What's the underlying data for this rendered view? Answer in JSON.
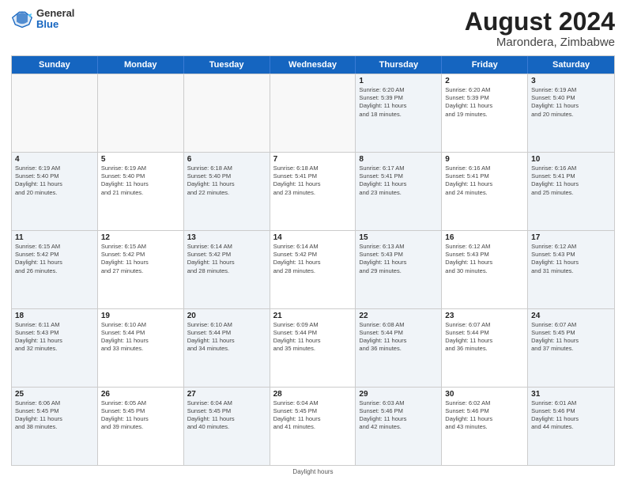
{
  "header": {
    "logo_general": "General",
    "logo_blue": "Blue",
    "month_title": "August 2024",
    "subtitle": "Marondera, Zimbabwe"
  },
  "footer": {
    "note": "Daylight hours"
  },
  "weekdays": [
    "Sunday",
    "Monday",
    "Tuesday",
    "Wednesday",
    "Thursday",
    "Friday",
    "Saturday"
  ],
  "weeks": [
    [
      {
        "day": "",
        "info": "",
        "empty": true
      },
      {
        "day": "",
        "info": "",
        "empty": true
      },
      {
        "day": "",
        "info": "",
        "empty": true
      },
      {
        "day": "",
        "info": "",
        "empty": true
      },
      {
        "day": "1",
        "info": "Sunrise: 6:20 AM\nSunset: 5:39 PM\nDaylight: 11 hours\nand 18 minutes.",
        "empty": false
      },
      {
        "day": "2",
        "info": "Sunrise: 6:20 AM\nSunset: 5:39 PM\nDaylight: 11 hours\nand 19 minutes.",
        "empty": false
      },
      {
        "day": "3",
        "info": "Sunrise: 6:19 AM\nSunset: 5:40 PM\nDaylight: 11 hours\nand 20 minutes.",
        "empty": false
      }
    ],
    [
      {
        "day": "4",
        "info": "Sunrise: 6:19 AM\nSunset: 5:40 PM\nDaylight: 11 hours\nand 20 minutes.",
        "empty": false
      },
      {
        "day": "5",
        "info": "Sunrise: 6:19 AM\nSunset: 5:40 PM\nDaylight: 11 hours\nand 21 minutes.",
        "empty": false
      },
      {
        "day": "6",
        "info": "Sunrise: 6:18 AM\nSunset: 5:40 PM\nDaylight: 11 hours\nand 22 minutes.",
        "empty": false
      },
      {
        "day": "7",
        "info": "Sunrise: 6:18 AM\nSunset: 5:41 PM\nDaylight: 11 hours\nand 23 minutes.",
        "empty": false
      },
      {
        "day": "8",
        "info": "Sunrise: 6:17 AM\nSunset: 5:41 PM\nDaylight: 11 hours\nand 23 minutes.",
        "empty": false
      },
      {
        "day": "9",
        "info": "Sunrise: 6:16 AM\nSunset: 5:41 PM\nDaylight: 11 hours\nand 24 minutes.",
        "empty": false
      },
      {
        "day": "10",
        "info": "Sunrise: 6:16 AM\nSunset: 5:41 PM\nDaylight: 11 hours\nand 25 minutes.",
        "empty": false
      }
    ],
    [
      {
        "day": "11",
        "info": "Sunrise: 6:15 AM\nSunset: 5:42 PM\nDaylight: 11 hours\nand 26 minutes.",
        "empty": false
      },
      {
        "day": "12",
        "info": "Sunrise: 6:15 AM\nSunset: 5:42 PM\nDaylight: 11 hours\nand 27 minutes.",
        "empty": false
      },
      {
        "day": "13",
        "info": "Sunrise: 6:14 AM\nSunset: 5:42 PM\nDaylight: 11 hours\nand 28 minutes.",
        "empty": false
      },
      {
        "day": "14",
        "info": "Sunrise: 6:14 AM\nSunset: 5:42 PM\nDaylight: 11 hours\nand 28 minutes.",
        "empty": false
      },
      {
        "day": "15",
        "info": "Sunrise: 6:13 AM\nSunset: 5:43 PM\nDaylight: 11 hours\nand 29 minutes.",
        "empty": false
      },
      {
        "day": "16",
        "info": "Sunrise: 6:12 AM\nSunset: 5:43 PM\nDaylight: 11 hours\nand 30 minutes.",
        "empty": false
      },
      {
        "day": "17",
        "info": "Sunrise: 6:12 AM\nSunset: 5:43 PM\nDaylight: 11 hours\nand 31 minutes.",
        "empty": false
      }
    ],
    [
      {
        "day": "18",
        "info": "Sunrise: 6:11 AM\nSunset: 5:43 PM\nDaylight: 11 hours\nand 32 minutes.",
        "empty": false
      },
      {
        "day": "19",
        "info": "Sunrise: 6:10 AM\nSunset: 5:44 PM\nDaylight: 11 hours\nand 33 minutes.",
        "empty": false
      },
      {
        "day": "20",
        "info": "Sunrise: 6:10 AM\nSunset: 5:44 PM\nDaylight: 11 hours\nand 34 minutes.",
        "empty": false
      },
      {
        "day": "21",
        "info": "Sunrise: 6:09 AM\nSunset: 5:44 PM\nDaylight: 11 hours\nand 35 minutes.",
        "empty": false
      },
      {
        "day": "22",
        "info": "Sunrise: 6:08 AM\nSunset: 5:44 PM\nDaylight: 11 hours\nand 36 minutes.",
        "empty": false
      },
      {
        "day": "23",
        "info": "Sunrise: 6:07 AM\nSunset: 5:44 PM\nDaylight: 11 hours\nand 36 minutes.",
        "empty": false
      },
      {
        "day": "24",
        "info": "Sunrise: 6:07 AM\nSunset: 5:45 PM\nDaylight: 11 hours\nand 37 minutes.",
        "empty": false
      }
    ],
    [
      {
        "day": "25",
        "info": "Sunrise: 6:06 AM\nSunset: 5:45 PM\nDaylight: 11 hours\nand 38 minutes.",
        "empty": false
      },
      {
        "day": "26",
        "info": "Sunrise: 6:05 AM\nSunset: 5:45 PM\nDaylight: 11 hours\nand 39 minutes.",
        "empty": false
      },
      {
        "day": "27",
        "info": "Sunrise: 6:04 AM\nSunset: 5:45 PM\nDaylight: 11 hours\nand 40 minutes.",
        "empty": false
      },
      {
        "day": "28",
        "info": "Sunrise: 6:04 AM\nSunset: 5:45 PM\nDaylight: 11 hours\nand 41 minutes.",
        "empty": false
      },
      {
        "day": "29",
        "info": "Sunrise: 6:03 AM\nSunset: 5:46 PM\nDaylight: 11 hours\nand 42 minutes.",
        "empty": false
      },
      {
        "day": "30",
        "info": "Sunrise: 6:02 AM\nSunset: 5:46 PM\nDaylight: 11 hours\nand 43 minutes.",
        "empty": false
      },
      {
        "day": "31",
        "info": "Sunrise: 6:01 AM\nSunset: 5:46 PM\nDaylight: 11 hours\nand 44 minutes.",
        "empty": false
      }
    ]
  ]
}
